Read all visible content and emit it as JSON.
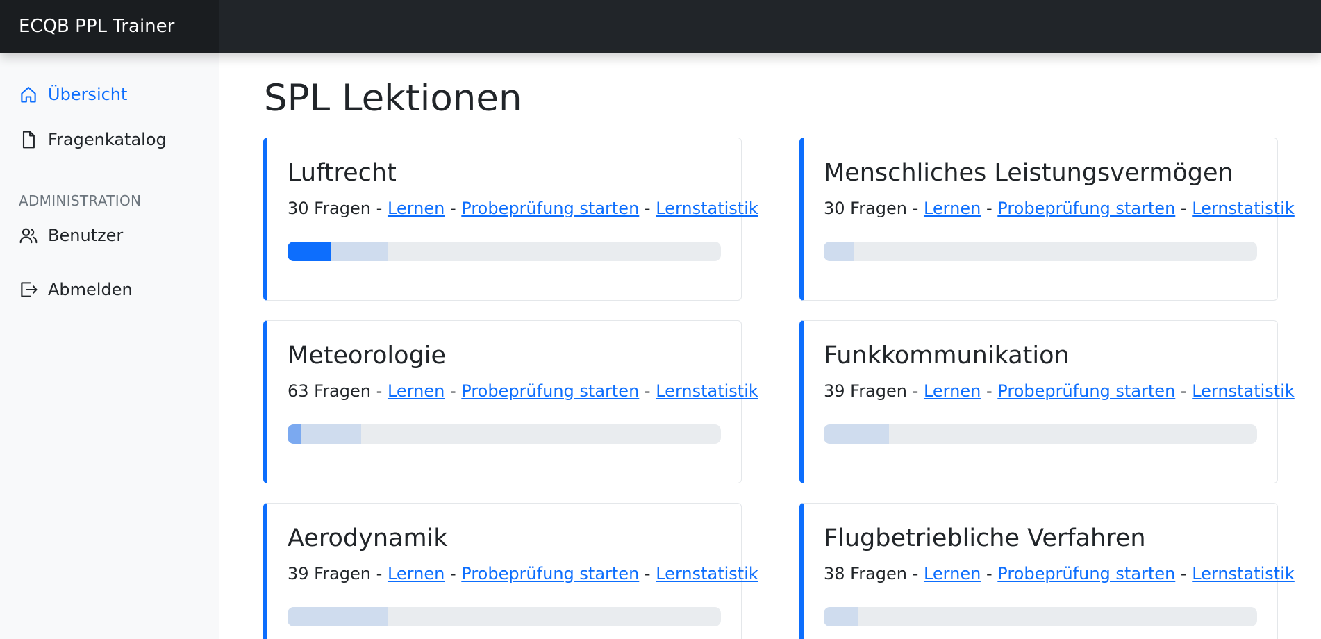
{
  "app": {
    "brand": "ECQB PPL Trainer"
  },
  "sidebar": {
    "items": [
      {
        "label": "Übersicht",
        "icon": "home-icon",
        "active": true
      },
      {
        "label": "Fragenkatalog",
        "icon": "document-icon",
        "active": false
      }
    ],
    "admin_heading": "ADMINISTRATION",
    "admin_items": [
      {
        "label": "Benutzer",
        "icon": "users-icon"
      },
      {
        "label": "Abmelden",
        "icon": "logout-icon"
      }
    ]
  },
  "main": {
    "title": "SPL Lektionen",
    "link_learn": "Lernen",
    "link_exam": "Probeprüfung starten",
    "link_stats": "Lernstatistik",
    "separator": "-",
    "lessons": [
      {
        "title": "Luftrecht",
        "count": "30 Fragen",
        "progress": {
          "learned": 0.1,
          "partial": 0.0,
          "seen": 0.13
        }
      },
      {
        "title": "Menschliches Leistungsvermögen",
        "count": "30 Fragen",
        "progress": {
          "learned": 0.0,
          "partial": 0.0,
          "seen": 0.07
        }
      },
      {
        "title": "Meteorologie",
        "count": "63 Fragen",
        "progress": {
          "learned": 0.0,
          "partial": 0.03,
          "seen": 0.14
        }
      },
      {
        "title": "Funkkommunikation",
        "count": "39 Fragen",
        "progress": {
          "learned": 0.0,
          "partial": 0.0,
          "seen": 0.15
        }
      },
      {
        "title": "Aerodynamik",
        "count": "39 Fragen",
        "progress": {
          "learned": 0.0,
          "partial": 0.0,
          "seen": 0.23
        }
      },
      {
        "title": "Flugbetriebliche Verfahren",
        "count": "38 Fragen",
        "progress": {
          "learned": 0.0,
          "partial": 0.0,
          "seen": 0.08
        }
      }
    ]
  },
  "colors": {
    "accent": "#0d6efd",
    "topbar": "#212529",
    "progress_learned": "#0d6efd",
    "progress_partial": "#7ba9f0",
    "progress_seen": "#cfdcee",
    "progress_track": "#e9ecef"
  }
}
